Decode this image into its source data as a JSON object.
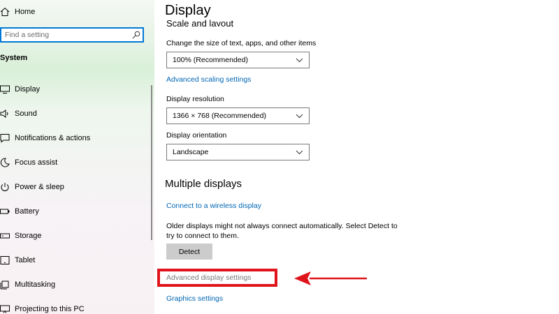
{
  "sidebar": {
    "home_label": "Home",
    "search": {
      "placeholder": "Find a setting"
    },
    "section_title": "System",
    "items": [
      {
        "label": "Display",
        "icon": "monitor-icon"
      },
      {
        "label": "Sound",
        "icon": "speaker-icon"
      },
      {
        "label": "Notifications & actions",
        "icon": "notification-icon"
      },
      {
        "label": "Focus assist",
        "icon": "moon-icon"
      },
      {
        "label": "Power & sleep",
        "icon": "power-icon"
      },
      {
        "label": "Battery",
        "icon": "battery-icon"
      },
      {
        "label": "Storage",
        "icon": "storage-icon"
      },
      {
        "label": "Tablet",
        "icon": "tablet-icon"
      },
      {
        "label": "Multitasking",
        "icon": "multitasking-icon"
      },
      {
        "label": "Projecting to this PC",
        "icon": "projecting-icon"
      }
    ]
  },
  "main": {
    "title": "Display",
    "scale_section_title": "Scale and layout",
    "scale_label": "Change the size of text, apps, and other items",
    "scale_value": "100% (Recommended)",
    "advanced_scaling_link": "Advanced scaling settings",
    "resolution_label": "Display resolution",
    "resolution_value": "1366 × 768 (Recommended)",
    "orientation_label": "Display orientation",
    "orientation_value": "Landscape",
    "multiple_displays_heading": "Multiple displays",
    "wireless_link": "Connect to a wireless display",
    "older_displays_text": "Older displays might not always connect automatically. Select Detect to try to connect to them.",
    "detect_button": "Detect",
    "advanced_display_link": "Advanced display settings",
    "graphics_link": "Graphics settings"
  },
  "colors": {
    "accent": "#0078d7",
    "link": "#0066b4",
    "highlight": "#e0141b"
  }
}
